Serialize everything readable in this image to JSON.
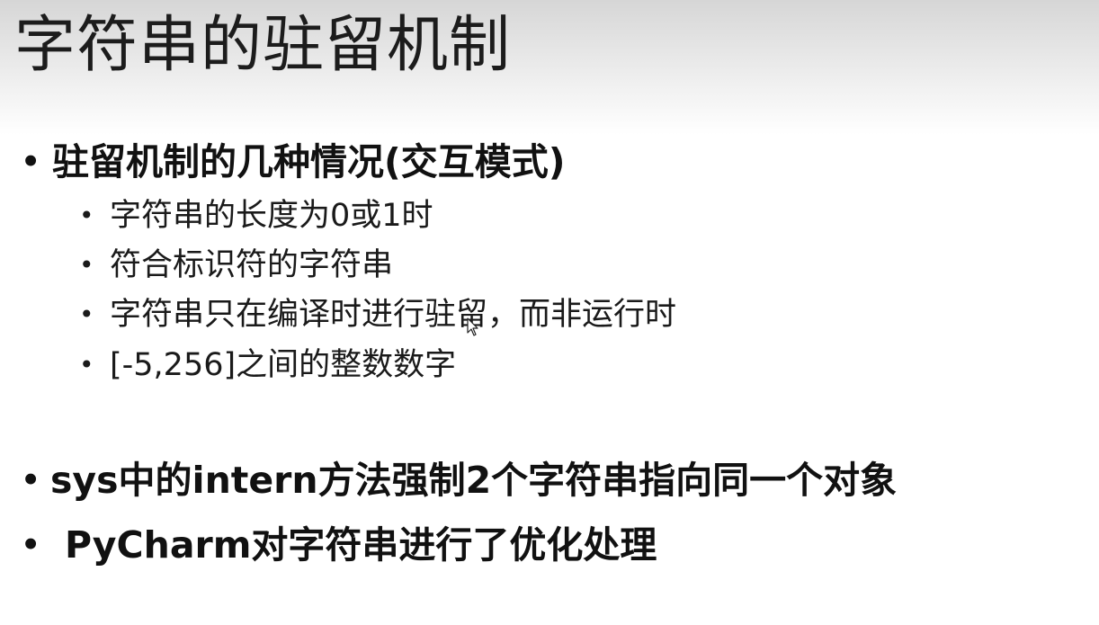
{
  "slide": {
    "title": "字符串的驻留机制",
    "bullets": [
      {
        "text": "驻留机制的几种情况(交互模式)",
        "sub_items": [
          "字符串的长度为0或1时",
          "符合标识符的字符串",
          "字符串只在编译时进行驻留，而非运行时",
          "[-5,256]之间的整数数字"
        ]
      },
      {
        "text": "sys中的intern方法强制2个字符串指向同一个对象"
      },
      {
        "text": "PyCharm对字符串进行了优化处理"
      }
    ]
  },
  "icons": {
    "bullet": "•",
    "cursor": "mouse-pointer-icon"
  }
}
